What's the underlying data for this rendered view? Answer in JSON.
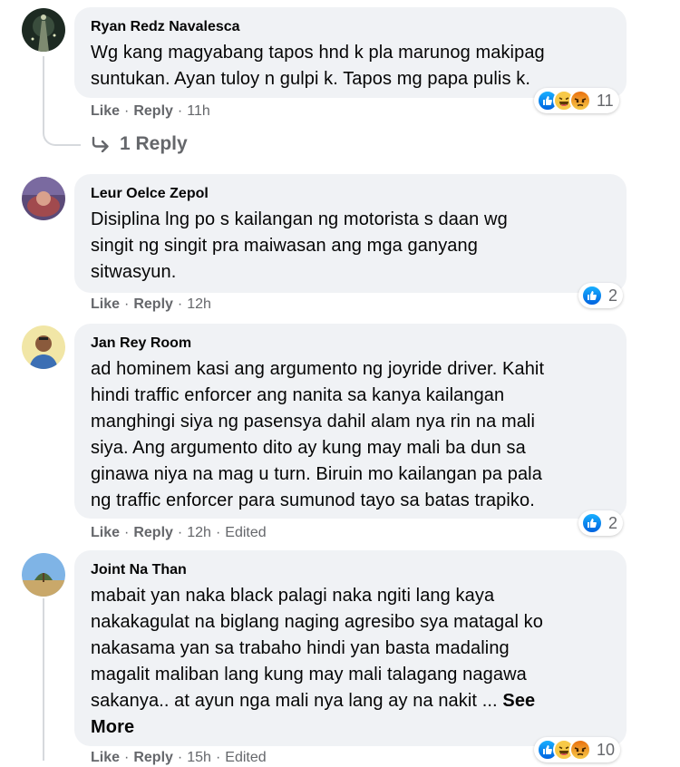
{
  "comments": [
    {
      "author": "Ryan Redz Navalesca",
      "lines": [
        "Wg kang magyabang tapos hnd k pla marunog makipag",
        "suntukan. Ayan tuloy n gulpi k. Tapos mg papa pulis k."
      ],
      "actions": {
        "like": "Like",
        "reply": "Reply",
        "time": "11h",
        "edited": ""
      },
      "reactions": {
        "icons": [
          "like-icon",
          "haha-icon",
          "angry-icon"
        ],
        "count": "11"
      },
      "replies": "1 Reply"
    },
    {
      "author": "Leur Oelce Zepol",
      "lines": [
        "Disiplina lng po s kailangan ng motorista s daan wg",
        "singit ng singit pra maiwasan ang mga ganyang",
        "sitwasyun."
      ],
      "actions": {
        "like": "Like",
        "reply": "Reply",
        "time": "12h",
        "edited": ""
      },
      "reactions": {
        "icons": [
          "like-icon"
        ],
        "count": "2"
      }
    },
    {
      "author": "Jan Rey Room",
      "lines": [
        "ad hominem kasi ang argumento ng joyride driver. Kahit",
        "hindi traffic enforcer ang nanita sa kanya kailangan",
        "manghingi siya ng pasensya dahil alam nya rin na mali",
        "siya. Ang argumento dito ay kung may mali ba dun sa",
        "ginawa niya na mag u turn. Biruin mo kailangan pa pala",
        "ng traffic enforcer para sumunod tayo sa batas trapiko."
      ],
      "actions": {
        "like": "Like",
        "reply": "Reply",
        "time": "12h",
        "edited": "Edited"
      },
      "reactions": {
        "icons": [
          "like-icon"
        ],
        "count": "2"
      }
    },
    {
      "author": "Joint Na Than",
      "lines": [
        "mabait yan naka black palagi naka ngiti lang kaya",
        "nakakagulat na biglang naging agresibo sya matagal ko",
        "nakasama yan sa trabaho hindi yan basta madaling",
        "magalit maliban lang kung may mali talagang nagawa",
        "sakanya.. at ayun nga mali nya lang ay na nakit ..."
      ],
      "see_more_a": "See",
      "see_more_b": "More",
      "actions": {
        "like": "Like",
        "reply": "Reply",
        "time": "15h",
        "edited": "Edited"
      },
      "reactions": {
        "icons": [
          "like-icon",
          "haha-icon",
          "angry-icon"
        ],
        "count": "10"
      }
    }
  ],
  "colors": {
    "bubble": "#f0f2f5",
    "meta": "#65676b",
    "like": "#1877f2"
  }
}
